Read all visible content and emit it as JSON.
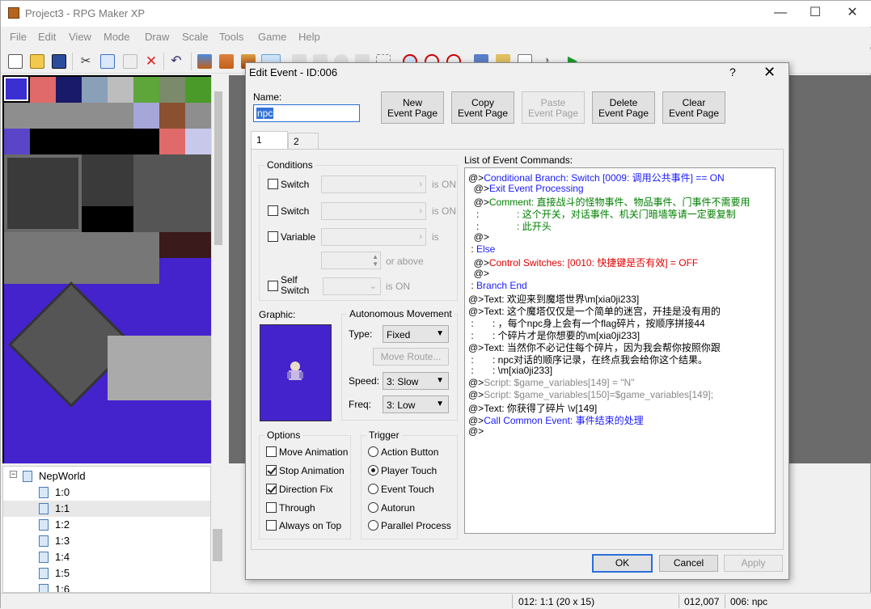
{
  "app": {
    "title": "Project3 - RPG Maker XP",
    "window_controls": {
      "minimize": "—",
      "maximize": "☐",
      "close": "✕"
    }
  },
  "menu": [
    "File",
    "Edit",
    "View",
    "Mode",
    "Draw",
    "Scale",
    "Tools",
    "Game",
    "Help"
  ],
  "toolbar": {
    "icons": [
      "new-project-icon",
      "open-project-icon",
      "save-icon",
      "cut-icon",
      "copy-icon",
      "paste-icon",
      "delete-icon",
      "undo-icon",
      "layer1-icon",
      "layer2-icon",
      "layer3-icon",
      "events-layer-icon",
      "pencil-icon",
      "rectangle-icon",
      "ellipse-icon",
      "fill-icon",
      "select-icon",
      "zoom-1-1-icon",
      "zoom-1-2-icon",
      "zoom-1-4-icon",
      "database-icon",
      "materialbase-icon",
      "script-editor-icon",
      "sound-test-icon",
      "playtest-icon"
    ]
  },
  "map_tree": {
    "root": "NepWorld",
    "items": [
      "1:0",
      "1:1",
      "1:2",
      "1:3",
      "1:4",
      "1:5",
      "1:6"
    ],
    "selected": "1:1"
  },
  "status": {
    "map": "012: 1:1 (20 x 15)",
    "coords": "012,007",
    "event": "006: npc"
  },
  "dialog": {
    "title": "Edit Event - ID:006",
    "help": "?",
    "close": "✕",
    "name_label": "Name:",
    "name_value": "npc",
    "page_buttons": {
      "new": [
        "New",
        "Event Page"
      ],
      "copy": [
        "Copy",
        "Event Page"
      ],
      "paste": [
        "Paste",
        "Event Page"
      ],
      "delete": [
        "Delete",
        "Event Page"
      ],
      "clear": [
        "Clear",
        "Event Page"
      ]
    },
    "tabs": [
      "1",
      "2"
    ],
    "conditions": {
      "title": "Conditions",
      "switch1": "Switch",
      "switch2": "Switch",
      "variable": "Variable",
      "self_switch_line1": "Self",
      "self_switch_line2": "Switch",
      "is_on": "is ON",
      "is": "is",
      "or_above": "or above"
    },
    "graphic_label": "Graphic:",
    "autonomous": {
      "title": "Autonomous Movement",
      "type_label": "Type:",
      "type_value": "Fixed",
      "move_route": "Move Route...",
      "speed_label": "Speed:",
      "speed_value": "3: Slow",
      "freq_label": "Freq:",
      "freq_value": "3: Low"
    },
    "options": {
      "title": "Options",
      "items": [
        {
          "label": "Move Animation",
          "checked": false
        },
        {
          "label": "Stop Animation",
          "checked": true
        },
        {
          "label": "Direction Fix",
          "checked": true
        },
        {
          "label": "Through",
          "checked": false
        },
        {
          "label": "Always on Top",
          "checked": false
        }
      ]
    },
    "trigger": {
      "title": "Trigger",
      "items": [
        {
          "label": "Action Button",
          "selected": false
        },
        {
          "label": "Player Touch",
          "selected": true
        },
        {
          "label": "Event Touch",
          "selected": false
        },
        {
          "label": "Autorun",
          "selected": false
        },
        {
          "label": "Parallel Process",
          "selected": false
        }
      ]
    },
    "commands_label": "List of Event Commands:",
    "commands": [
      {
        "prefix": "@>",
        "text": "Conditional Branch: Switch [0009: 调用公共事件] == ON",
        "color": "blue",
        "indent": 0
      },
      {
        "prefix": "  @>",
        "text": "Exit Event Processing",
        "color": "blue",
        "indent": 0
      },
      {
        "prefix": "  @>",
        "text": "Comment: 直接战斗的怪物事件、物品事件、门事件不需要用",
        "color": "green",
        "indent": 0
      },
      {
        "prefix": "   :",
        "text": "              : 这个开关，对话事件、机关门暗墙等请一定要复制",
        "color": "green",
        "indent": 0
      },
      {
        "prefix": "   :",
        "text": "              : 此开头",
        "color": "green",
        "indent": 0
      },
      {
        "prefix": "  @>",
        "text": "",
        "color": "black",
        "indent": 0
      },
      {
        "prefix": " : ",
        "text": "Else",
        "color": "blue",
        "indent": 0
      },
      {
        "prefix": "  @>",
        "text": "Control Switches: [0010: 快捷键是否有效] = OFF",
        "color": "red",
        "indent": 0
      },
      {
        "prefix": "  @>",
        "text": "",
        "color": "black",
        "indent": 0
      },
      {
        "prefix": " : ",
        "text": "Branch End",
        "color": "blue",
        "indent": 0
      },
      {
        "prefix": "@>",
        "text": "Text: 欢迎来到魔塔世界\\m[xia0ji233]",
        "color": "black",
        "indent": 0
      },
      {
        "prefix": "@>",
        "text": "Text: 这个魔塔仅仅是一个简单的迷宫，开挂是没有用的",
        "color": "black",
        "indent": 0
      },
      {
        "prefix": " :",
        "text": "       : ，每个npc身上会有一个flag碎片，按顺序拼接44",
        "color": "black",
        "indent": 0
      },
      {
        "prefix": " :",
        "text": "       : 个碎片才是你想要的\\m[xia0ji233]",
        "color": "black",
        "indent": 0
      },
      {
        "prefix": "@>",
        "text": "Text: 当然你不必记住每个碎片，因为我会帮你按照你跟",
        "color": "black",
        "indent": 0
      },
      {
        "prefix": " :",
        "text": "       : npc对话的顺序记录，在终点我会给你这个结果。",
        "color": "black",
        "indent": 0
      },
      {
        "prefix": " :",
        "text": "       : \\m[xia0ji233]",
        "color": "black",
        "indent": 0
      },
      {
        "prefix": "@>",
        "text": "Script: $game_variables[149] = \"N\"",
        "color": "gray",
        "indent": 0
      },
      {
        "prefix": "@>",
        "text": "Script: $game_variables[150]=$game_variables[149];",
        "color": "gray",
        "indent": 0
      },
      {
        "prefix": "@>",
        "text": "Text: 你获得了碎片 \\v[149]",
        "color": "black",
        "indent": 0
      },
      {
        "prefix": "@>",
        "text": "Call Common Event: 事件结束的处理",
        "color": "blue",
        "indent": 0
      },
      {
        "prefix": "@>",
        "text": "",
        "color": "black",
        "indent": 0
      }
    ],
    "ok": "OK",
    "cancel": "Cancel",
    "apply": "Apply"
  }
}
